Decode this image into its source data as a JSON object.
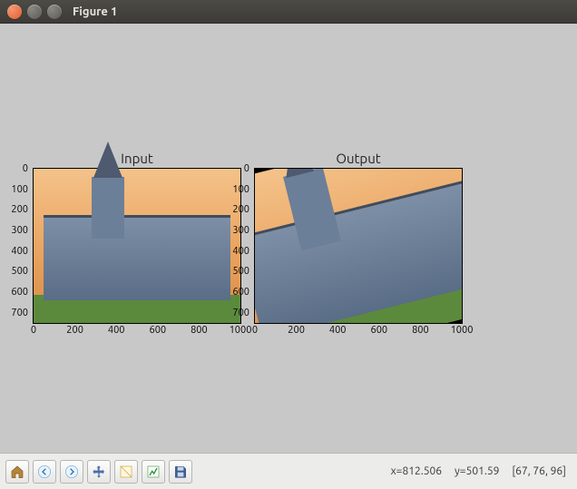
{
  "window": {
    "title": "Figure 1"
  },
  "subplots": [
    {
      "title": "Input",
      "yticks": [
        "0",
        "100",
        "200",
        "300",
        "400",
        "500",
        "600",
        "700"
      ],
      "xticks": [
        "0",
        "200",
        "400",
        "600",
        "800",
        "1000"
      ]
    },
    {
      "title": "Output",
      "yticks": [
        "0",
        "100",
        "200",
        "300",
        "400",
        "500",
        "600",
        "700"
      ],
      "xticks": [
        "0",
        "200",
        "400",
        "600",
        "800",
        "1000"
      ]
    }
  ],
  "toolbar": {
    "home": "Home",
    "back": "Back",
    "forward": "Forward",
    "pan": "Pan",
    "zoom": "Zoom",
    "subplots": "Configure subplots",
    "save": "Save"
  },
  "status": {
    "x_label": "x=812.506",
    "y_label": "y=501.59",
    "pixel": "[67, 76, 96]"
  },
  "chart_data": [
    {
      "type": "image",
      "title": "Input",
      "xlim": [
        0,
        1000
      ],
      "ylim": [
        0,
        750
      ],
      "description": "original photograph of a gothic building with orange sky and green lawn"
    },
    {
      "type": "image",
      "title": "Output",
      "xlim": [
        0,
        1000
      ],
      "ylim": [
        0,
        750
      ],
      "description": "same photograph rotated ~14° counter-clockwise with black fill in exposed corners"
    }
  ]
}
